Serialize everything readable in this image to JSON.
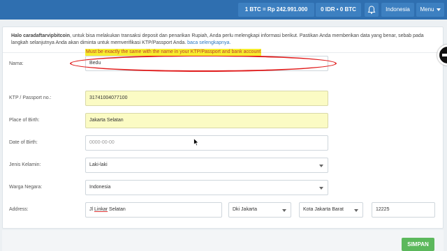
{
  "topbar": {
    "price_label": "1 BTC = Rp 242.991.000",
    "balance_label": "0 IDR • 0 BTC",
    "bell_icon": "bell-icon",
    "language_label": "Indonesia",
    "menu_label": "Menu"
  },
  "intro": {
    "username": "Halo caradaftarvipbitcoin",
    "text": ", untuk bisa melakukan transaksi deposit dan penarikan Rupiah, Anda perlu melengkapi informasi berikut. Pastikan Anda memberikan data yang benar, sebab pada langkah selanjutnya Anda akan diminta untuk memverifikasi KTP/Passport Anda. ",
    "link": "baca selengkapnya."
  },
  "form": {
    "nama": {
      "label": "Nama:",
      "value": "Bedu"
    },
    "hint": "Must be exactly the same with the name in your KTP/Passport and bank account",
    "ktp": {
      "label": "KTP / Passport no.:",
      "value": "31741004077100"
    },
    "place_of_birth": {
      "label": "Place of Birth:",
      "value": "Jakarta Selatan"
    },
    "date_of_birth": {
      "label": "Date of Birth:",
      "placeholder": "0000-00-00"
    },
    "gender": {
      "label": "Jenis Kelamin:",
      "value": "Laki-laki"
    },
    "citizenship": {
      "label": "Warga Negara:",
      "value": "Indonesia"
    },
    "address": {
      "label": "Address:",
      "street_prefix": "Jl ",
      "street_underlined": "Linkar",
      "street_suffix": " Selatan",
      "province": "Dki Jakarta",
      "city": "Kota Jakarta Barat",
      "postal": "12225"
    }
  },
  "footer": {
    "save_label": "SIMPAN"
  },
  "colors": {
    "topbar": "#2f6fb0",
    "save": "#5cb85c",
    "highlight": "#fbfbc4",
    "annotation": "#e01b1b"
  }
}
